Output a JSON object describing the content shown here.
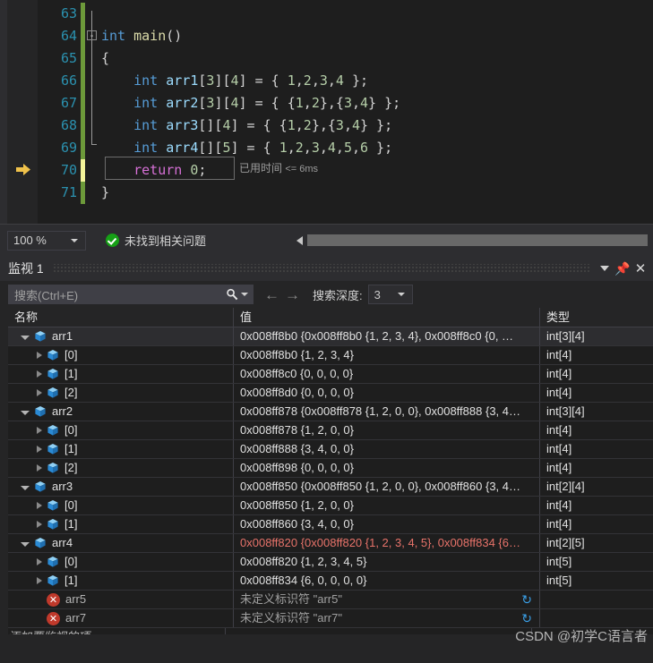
{
  "editor": {
    "lines": [
      {
        "num": "63",
        "change": "green",
        "tokens": []
      },
      {
        "num": "64",
        "change": "green",
        "collapse": "-",
        "tokens": [
          {
            "t": "int",
            "c": "kw"
          },
          {
            "t": " ",
            "c": "pun"
          },
          {
            "t": "main",
            "c": "fn"
          },
          {
            "t": "()",
            "c": "pun"
          }
        ]
      },
      {
        "num": "65",
        "change": "green",
        "tokens": [
          {
            "t": "{",
            "c": "pun"
          }
        ]
      },
      {
        "num": "66",
        "change": "green",
        "tokens": [
          {
            "t": "    ",
            "c": "pun"
          },
          {
            "t": "int",
            "c": "kw"
          },
          {
            "t": " ",
            "c": "pun"
          },
          {
            "t": "arr1",
            "c": "var"
          },
          {
            "t": "[",
            "c": "pun"
          },
          {
            "t": "3",
            "c": "num"
          },
          {
            "t": "][",
            "c": "pun"
          },
          {
            "t": "4",
            "c": "num"
          },
          {
            "t": "] = { ",
            "c": "pun"
          },
          {
            "t": "1",
            "c": "num"
          },
          {
            "t": ",",
            "c": "pun"
          },
          {
            "t": "2",
            "c": "num"
          },
          {
            "t": ",",
            "c": "pun"
          },
          {
            "t": "3",
            "c": "num"
          },
          {
            "t": ",",
            "c": "pun"
          },
          {
            "t": "4",
            "c": "num"
          },
          {
            "t": " };",
            "c": "pun"
          }
        ]
      },
      {
        "num": "67",
        "change": "green",
        "tokens": [
          {
            "t": "    ",
            "c": "pun"
          },
          {
            "t": "int",
            "c": "kw"
          },
          {
            "t": " ",
            "c": "pun"
          },
          {
            "t": "arr2",
            "c": "var"
          },
          {
            "t": "[",
            "c": "pun"
          },
          {
            "t": "3",
            "c": "num"
          },
          {
            "t": "][",
            "c": "pun"
          },
          {
            "t": "4",
            "c": "num"
          },
          {
            "t": "] = { {",
            "c": "pun"
          },
          {
            "t": "1",
            "c": "num"
          },
          {
            "t": ",",
            "c": "pun"
          },
          {
            "t": "2",
            "c": "num"
          },
          {
            "t": "},{",
            "c": "pun"
          },
          {
            "t": "3",
            "c": "num"
          },
          {
            "t": ",",
            "c": "pun"
          },
          {
            "t": "4",
            "c": "num"
          },
          {
            "t": "} };",
            "c": "pun"
          }
        ]
      },
      {
        "num": "68",
        "change": "green",
        "tokens": [
          {
            "t": "    ",
            "c": "pun"
          },
          {
            "t": "int",
            "c": "kw"
          },
          {
            "t": " ",
            "c": "pun"
          },
          {
            "t": "arr3",
            "c": "var"
          },
          {
            "t": "[][",
            "c": "pun"
          },
          {
            "t": "4",
            "c": "num"
          },
          {
            "t": "] = { {",
            "c": "pun"
          },
          {
            "t": "1",
            "c": "num"
          },
          {
            "t": ",",
            "c": "pun"
          },
          {
            "t": "2",
            "c": "num"
          },
          {
            "t": "},{",
            "c": "pun"
          },
          {
            "t": "3",
            "c": "num"
          },
          {
            "t": ",",
            "c": "pun"
          },
          {
            "t": "4",
            "c": "num"
          },
          {
            "t": "} };",
            "c": "pun"
          }
        ]
      },
      {
        "num": "69",
        "change": "green",
        "tokens": [
          {
            "t": "    ",
            "c": "pun"
          },
          {
            "t": "int",
            "c": "kw"
          },
          {
            "t": " ",
            "c": "pun"
          },
          {
            "t": "arr4",
            "c": "var"
          },
          {
            "t": "[][",
            "c": "pun"
          },
          {
            "t": "5",
            "c": "num"
          },
          {
            "t": "] = { ",
            "c": "pun"
          },
          {
            "t": "1",
            "c": "num"
          },
          {
            "t": ",",
            "c": "pun"
          },
          {
            "t": "2",
            "c": "num"
          },
          {
            "t": ",",
            "c": "pun"
          },
          {
            "t": "3",
            "c": "num"
          },
          {
            "t": ",",
            "c": "pun"
          },
          {
            "t": "4",
            "c": "num"
          },
          {
            "t": ",",
            "c": "pun"
          },
          {
            "t": "5",
            "c": "num"
          },
          {
            "t": ",",
            "c": "pun"
          },
          {
            "t": "6",
            "c": "num"
          },
          {
            "t": " };",
            "c": "pun"
          }
        ]
      },
      {
        "num": "70",
        "change": "yellow",
        "tokens": [
          {
            "t": "    ",
            "c": "pun"
          },
          {
            "t": "return",
            "c": "ctl"
          },
          {
            "t": " ",
            "c": "pun"
          },
          {
            "t": "0",
            "c": "num"
          },
          {
            "t": ";",
            "c": "pun"
          }
        ]
      },
      {
        "num": "71",
        "change": "green",
        "tokens": [
          {
            "t": "}",
            "c": "pun"
          }
        ]
      }
    ],
    "elapsed_label": "已用时间",
    "elapsed_value": "<= 6ms",
    "current_line_marker": "execution-arrow"
  },
  "statusbar": {
    "zoom": "100 %",
    "problem_status": "未找到相关问题"
  },
  "watch": {
    "title": "监视 1",
    "search_placeholder": "搜索(Ctrl+E)",
    "depth_label": "搜索深度:",
    "depth_value": "3",
    "columns": {
      "name": "名称",
      "value": "值",
      "type": "类型"
    },
    "add_row_placeholder": "添加要监视的项",
    "watermark": "CSDN @初学C语言者",
    "rows": [
      {
        "indent": 0,
        "twisty": "down",
        "icon": "cube",
        "name": "arr1",
        "value": "0x008ff8b0 {0x008ff8b0 {1, 2, 3, 4}, 0x008ff8c0 {0, …",
        "type": "int[3][4]",
        "selected": true,
        "value_color": "normal"
      },
      {
        "indent": 1,
        "twisty": "right",
        "icon": "cube",
        "name": "[0]",
        "value": "0x008ff8b0 {1, 2, 3, 4}",
        "type": "int[4]",
        "value_color": "normal"
      },
      {
        "indent": 1,
        "twisty": "right",
        "icon": "cube",
        "name": "[1]",
        "value": "0x008ff8c0 {0, 0, 0, 0}",
        "type": "int[4]",
        "value_color": "normal"
      },
      {
        "indent": 1,
        "twisty": "right",
        "icon": "cube",
        "name": "[2]",
        "value": "0x008ff8d0 {0, 0, 0, 0}",
        "type": "int[4]",
        "value_color": "normal"
      },
      {
        "indent": 0,
        "twisty": "down",
        "icon": "cube",
        "name": "arr2",
        "value": "0x008ff878 {0x008ff878 {1, 2, 0, 0}, 0x008ff888 {3, 4…",
        "type": "int[3][4]",
        "value_color": "normal"
      },
      {
        "indent": 1,
        "twisty": "right",
        "icon": "cube",
        "name": "[0]",
        "value": "0x008ff878 {1, 2, 0, 0}",
        "type": "int[4]",
        "value_color": "normal"
      },
      {
        "indent": 1,
        "twisty": "right",
        "icon": "cube",
        "name": "[1]",
        "value": "0x008ff888 {3, 4, 0, 0}",
        "type": "int[4]",
        "value_color": "normal"
      },
      {
        "indent": 1,
        "twisty": "right",
        "icon": "cube",
        "name": "[2]",
        "value": "0x008ff898 {0, 0, 0, 0}",
        "type": "int[4]",
        "value_color": "normal"
      },
      {
        "indent": 0,
        "twisty": "down",
        "icon": "cube",
        "name": "arr3",
        "value": "0x008ff850 {0x008ff850 {1, 2, 0, 0}, 0x008ff860 {3, 4…",
        "type": "int[2][4]",
        "value_color": "normal"
      },
      {
        "indent": 1,
        "twisty": "right",
        "icon": "cube",
        "name": "[0]",
        "value": "0x008ff850 {1, 2, 0, 0}",
        "type": "int[4]",
        "value_color": "normal"
      },
      {
        "indent": 1,
        "twisty": "right",
        "icon": "cube",
        "name": "[1]",
        "value": "0x008ff860 {3, 4, 0, 0}",
        "type": "int[4]",
        "value_color": "normal"
      },
      {
        "indent": 0,
        "twisty": "down",
        "icon": "cube",
        "name": "arr4",
        "value": "0x008ff820 {0x008ff820 {1, 2, 3, 4, 5}, 0x008ff834 {6…",
        "type": "int[2][5]",
        "value_color": "red"
      },
      {
        "indent": 1,
        "twisty": "right",
        "icon": "cube",
        "name": "[0]",
        "value": "0x008ff820 {1, 2, 3, 4, 5}",
        "type": "int[5]",
        "value_color": "normal"
      },
      {
        "indent": 1,
        "twisty": "right",
        "icon": "cube",
        "name": "[1]",
        "value": "0x008ff834 {6, 0, 0, 0, 0}",
        "type": "int[5]",
        "value_color": "normal"
      },
      {
        "indent": 1,
        "twisty": "none",
        "icon": "error",
        "name": "arr5",
        "value": "未定义标识符 \"arr5\"",
        "type": "",
        "value_color": "err",
        "refresh": true
      },
      {
        "indent": 1,
        "twisty": "none",
        "icon": "error",
        "name": "arr7",
        "value": "未定义标识符 \"arr7\"",
        "type": "",
        "value_color": "err",
        "refresh": true
      }
    ]
  }
}
